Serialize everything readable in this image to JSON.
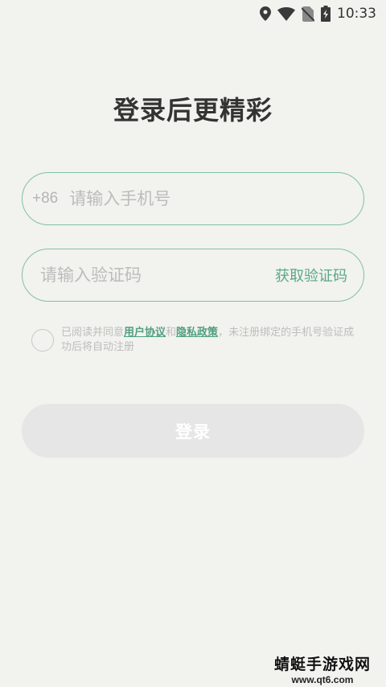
{
  "status_bar": {
    "time": "10:33",
    "icons": [
      "location-icon",
      "wifi-icon",
      "no-sim-icon",
      "battery-charging-icon"
    ]
  },
  "login": {
    "title": "登录后更精彩",
    "phone_prefix": "+86",
    "phone_placeholder": "请输入手机号",
    "code_placeholder": "请输入验证码",
    "get_code_label": "获取验证码",
    "agreement": {
      "prefix": "已阅读并同意",
      "user_agreement": "用户协议",
      "and": "和",
      "privacy_policy": "隐私政策",
      "suffix": "，未注册绑定的手机号验证成功后将自动注册"
    },
    "login_button": "登录"
  },
  "watermark": {
    "title": "蜻蜓手游戏网",
    "url": "www.qt6.com"
  },
  "colors": {
    "background": "#f2f2ee",
    "accent": "#5aa888",
    "field_border": "#7fc2a4",
    "button_disabled": "#e6e6e6"
  }
}
